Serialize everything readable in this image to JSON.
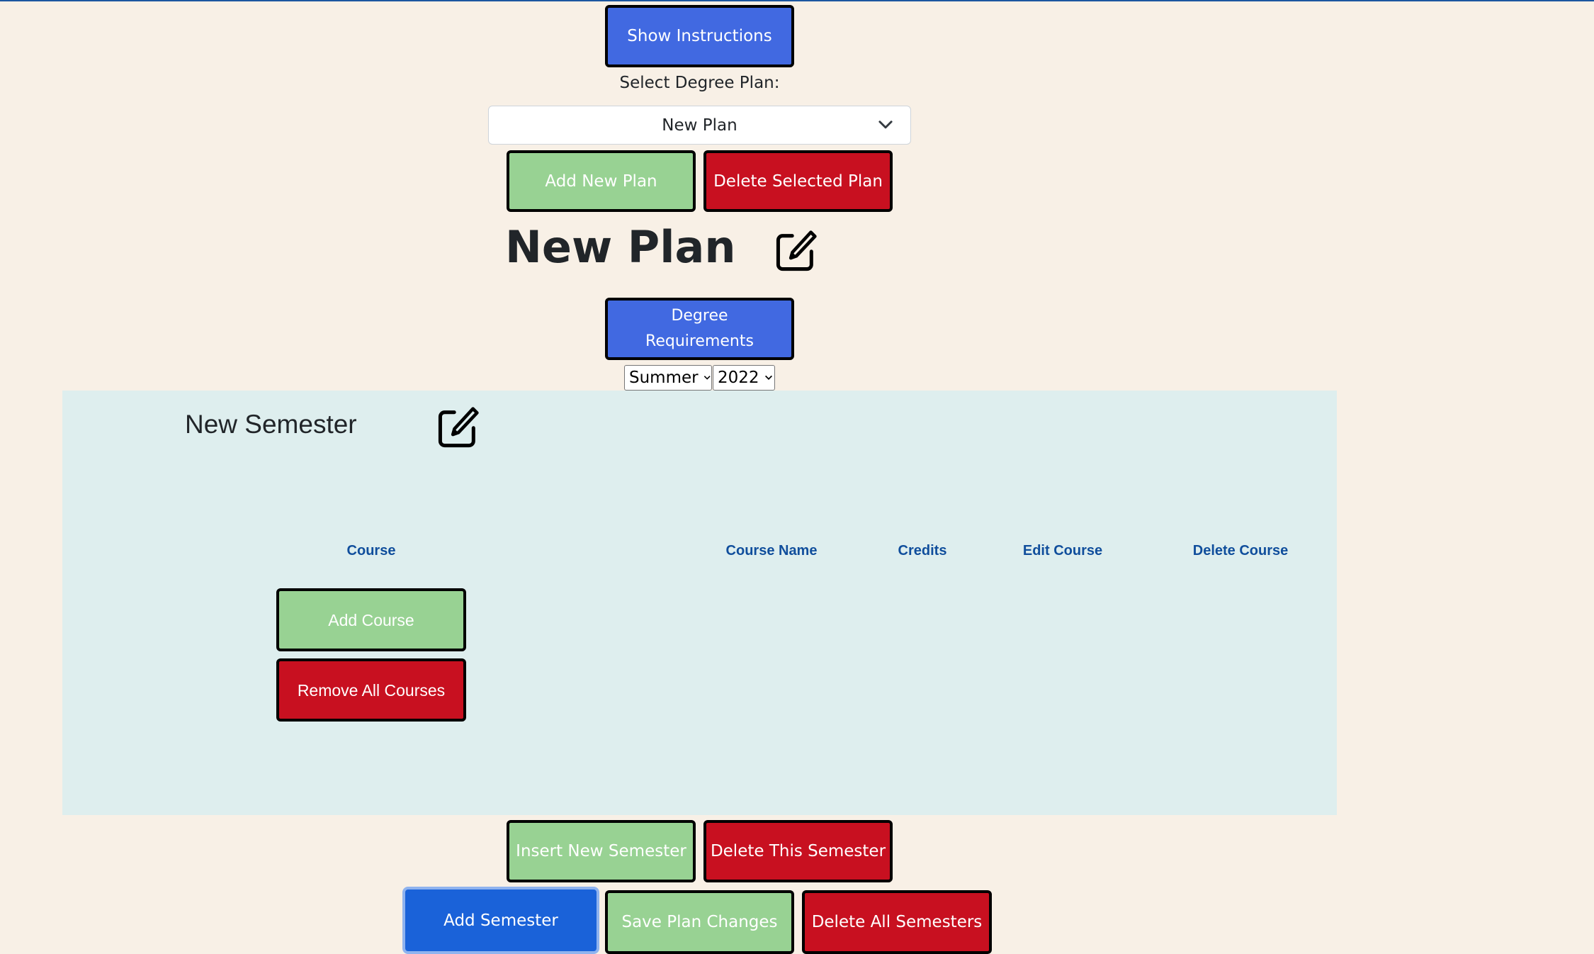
{
  "header": {
    "show_instructions_label": "Show Instructions",
    "select_plan_label": "Select Degree Plan:",
    "selected_plan": "New Plan",
    "add_plan_label": "Add New Plan",
    "delete_plan_label": "Delete Selected Plan"
  },
  "plan": {
    "title": "New Plan",
    "edit_icon": "pencil-square-icon",
    "degree_requirements_label": "Degree Requirements"
  },
  "term_picker": {
    "season": "Summer",
    "year": "2022"
  },
  "semester": {
    "title": "New Semester",
    "edit_icon": "pencil-square-icon",
    "columns": [
      "Course",
      "Course Name",
      "Credits",
      "Edit Course",
      "Delete Course"
    ],
    "rows": [],
    "add_course_label": "Add Course",
    "remove_all_label": "Remove All Courses",
    "insert_semester_label": "Insert New Semester",
    "delete_semester_label": "Delete This Semester"
  },
  "footer": {
    "add_semester_label": "Add Semester",
    "save_plan_label": "Save Plan Changes",
    "delete_all_label": "Delete All Semesters"
  },
  "colors": {
    "background": "#f8f0e6",
    "panel": "#deeeee",
    "primary_blue": "#4169e1",
    "add_green": "#98d293",
    "delete_red": "#c81020",
    "header_text": "#104e9c"
  }
}
